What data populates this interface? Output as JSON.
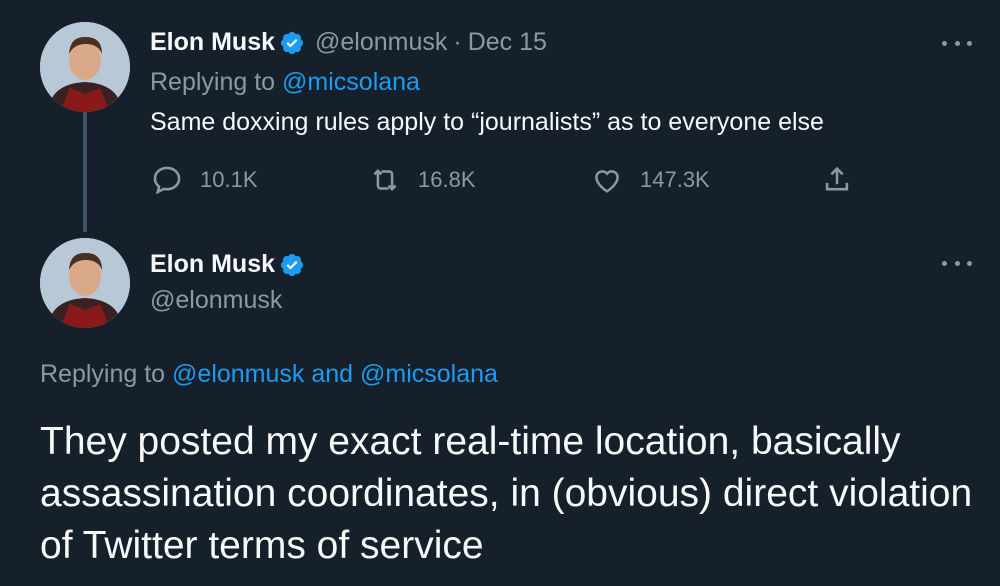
{
  "tweet1": {
    "name": "Elon Musk",
    "handle": "@elonmusk",
    "separator": "·",
    "date": "Dec 15",
    "replying_prefix": "Replying to",
    "replying_to": "@micsolana",
    "text": "Same doxxing rules apply to “journalists” as to everyone else",
    "stats": {
      "replies": "10.1K",
      "retweets": "16.8K",
      "likes": "147.3K"
    }
  },
  "tweet2": {
    "name": "Elon Musk",
    "handle": "@elonmusk",
    "replying_prefix": "Replying to",
    "replying_to": "@elonmusk and @micsolana",
    "text": "They posted my exact real-time location, basically assassination coordinates, in (obvious) direct violation of Twitter terms of service"
  },
  "icons": {
    "verified": "verified-badge-icon",
    "reply": "reply-icon",
    "retweet": "retweet-icon",
    "like": "heart-icon",
    "share": "share-icon",
    "more": "more-icon"
  },
  "colors": {
    "background": "#15202b",
    "accent": "#1d9bf0",
    "secondary_text": "#8b98a5",
    "primary_text": "#f7f9f9"
  }
}
